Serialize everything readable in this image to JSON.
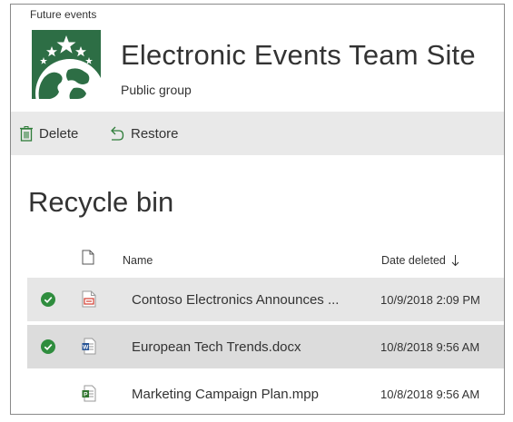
{
  "breadcrumb": "Future events",
  "site": {
    "title": "Electronic Events Team Site",
    "subtitle": "Public group",
    "logo_color": "#2d6e45"
  },
  "command_bar": {
    "delete_label": "Delete",
    "restore_label": "Restore",
    "delete_icon": "trash-icon",
    "restore_icon": "undo-arrow-icon"
  },
  "page_title": "Recycle bin",
  "table": {
    "columns": {
      "type_icon": "document-icon",
      "name": "Name",
      "date_deleted": "Date deleted",
      "sort": "descending"
    },
    "rows": [
      {
        "name": "Contoso Electronics Announces ...",
        "date": "10/9/2018 2:09 PM",
        "file_type": "pdf",
        "selected": true
      },
      {
        "name": "European Tech Trends.docx",
        "date": "10/8/2018 9:56 AM",
        "file_type": "docx",
        "selected": true
      },
      {
        "name": "Marketing Campaign Plan.mpp",
        "date": "10/8/2018 9:56 AM",
        "file_type": "mpp",
        "selected": false
      }
    ]
  },
  "colors": {
    "check": "#2f8d3e",
    "selected_row": "#e6e6e6",
    "command_bar": "#e9e9e9"
  }
}
